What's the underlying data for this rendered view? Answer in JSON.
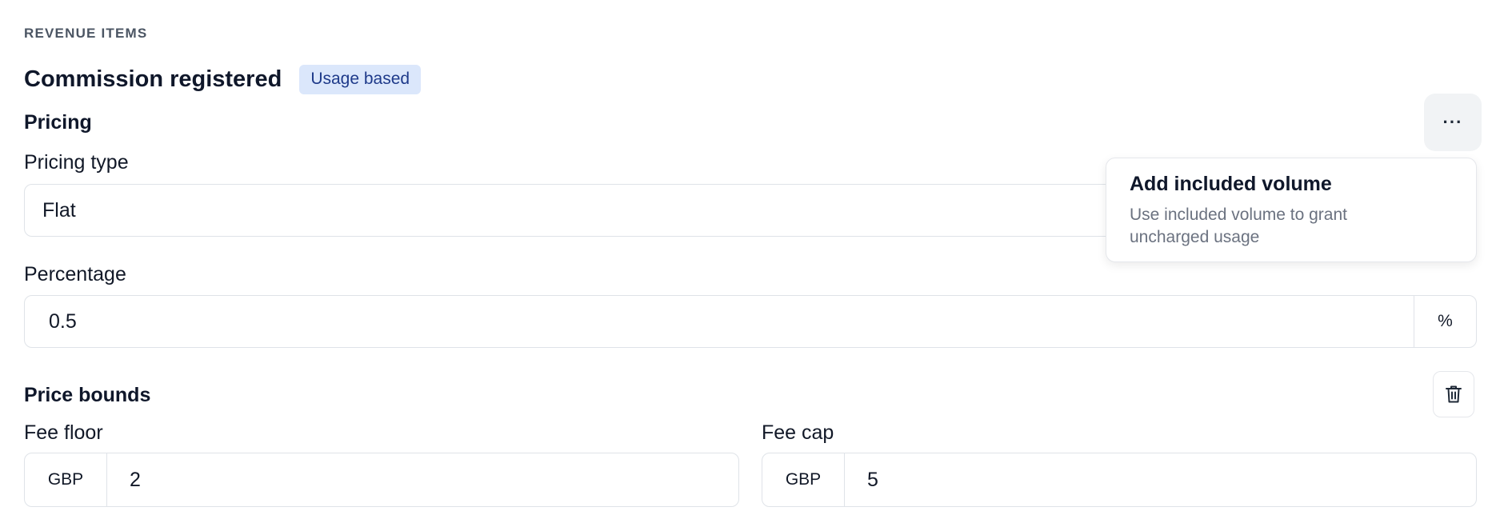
{
  "section": {
    "label": "REVENUE ITEMS"
  },
  "item": {
    "title": "Commission registered",
    "badge": "Usage based"
  },
  "pricing": {
    "heading": "Pricing",
    "more_label": "···",
    "type_label": "Pricing type",
    "type_value": "Flat",
    "percentage_label": "Percentage",
    "percentage_value": "0.5",
    "percentage_suffix": "%"
  },
  "dropdown": {
    "title": "Add included volume",
    "description": "Use included volume to grant uncharged usage"
  },
  "bounds": {
    "heading": "Price bounds",
    "floor_label": "Fee floor",
    "floor_currency": "GBP",
    "floor_value": "2",
    "cap_label": "Fee cap",
    "cap_currency": "GBP",
    "cap_value": "5"
  },
  "icons": {
    "more": "more-horizontal-icon",
    "delete": "trash-icon"
  }
}
